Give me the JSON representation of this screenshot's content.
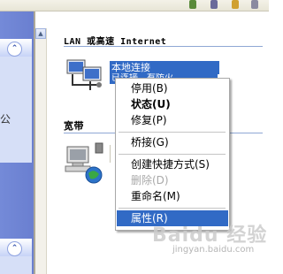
{
  "taskpane": {
    "fragment_char": "公",
    "bottom_fragment": ""
  },
  "groups": {
    "lan_title": "LAN 或高速 Internet",
    "broadband_title": "宽带"
  },
  "connection": {
    "name": "本地连接",
    "status_fragment": "已连接…有防火"
  },
  "context_menu": {
    "items": [
      {
        "label": "停用(B)",
        "style": "normal"
      },
      {
        "label": "状态(U)",
        "style": "bold"
      },
      {
        "label": "修复(P)",
        "style": "normal"
      },
      {
        "label": "桥接(G)",
        "style": "normal"
      },
      {
        "label": "创建快捷方式(S)",
        "style": "normal"
      },
      {
        "label": "删除(D)",
        "style": "disabled"
      },
      {
        "label": "重命名(M)",
        "style": "normal"
      },
      {
        "label": "属性(R)",
        "style": "selected"
      }
    ]
  },
  "watermark": {
    "main": "Baidu 经验",
    "sub": "jingyan.baidu.com"
  },
  "colors": {
    "selection": "#316ac5",
    "taskpane": "#6a7fd0"
  },
  "icons": [
    "network-connection-icon",
    "broadband-connection-icon",
    "collapse-up-icon",
    "scroll-up-arrow-icon"
  ]
}
